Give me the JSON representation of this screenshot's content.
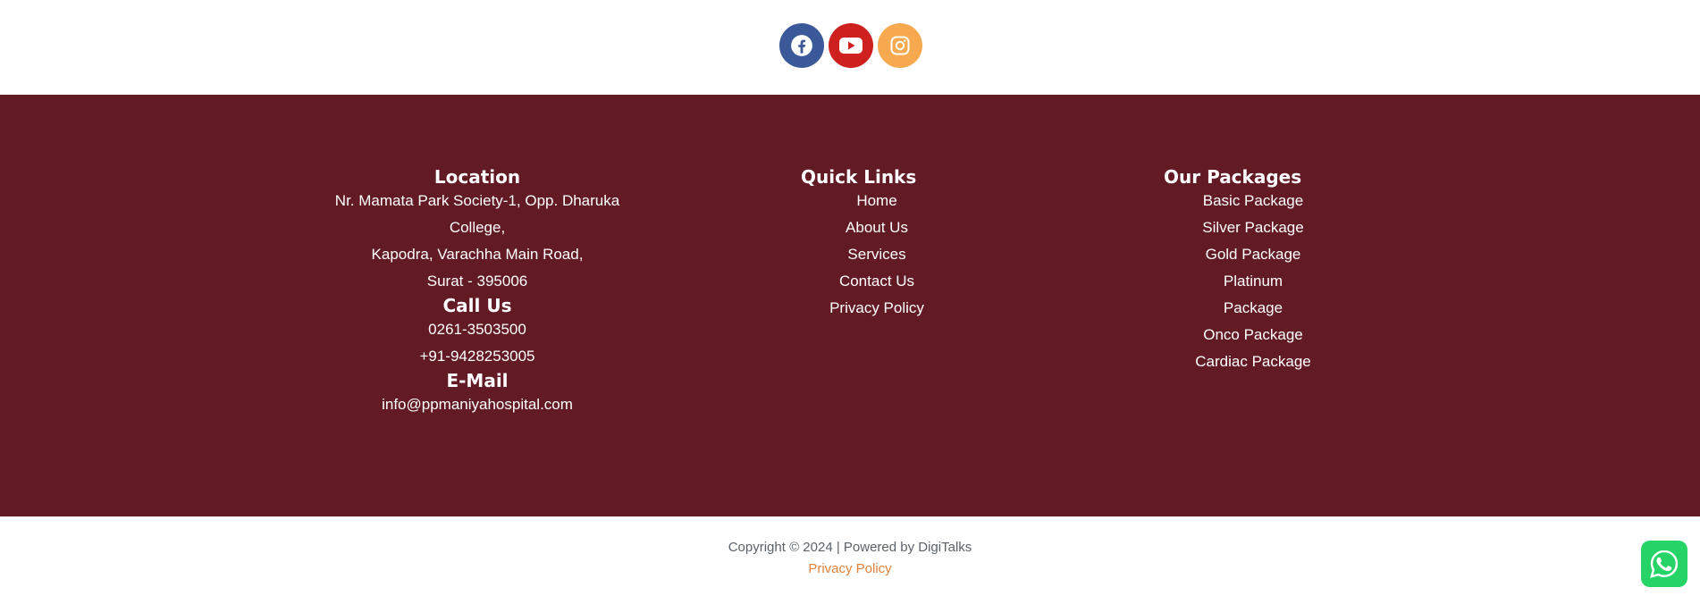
{
  "social": {
    "icons": [
      "facebook-icon",
      "youtube-icon",
      "instagram-icon"
    ],
    "colors": {
      "facebook": "#3b5998",
      "youtube": "#cd201f",
      "instagram": "#f6a94f"
    }
  },
  "footer": {
    "background": "#621a25",
    "location": {
      "heading": "Location",
      "lines": [
        "Nr. Mamata Park Society-1, Opp. Dharuka",
        "College,",
        "Kapodra, Varachha Main Road,",
        "Surat - 395006"
      ]
    },
    "call": {
      "heading": "Call Us",
      "numbers": [
        "0261-3503500",
        "+91-9428253005"
      ]
    },
    "email": {
      "heading": "E-Mail",
      "address": "info@ppmaniyahospital.com"
    },
    "quick_links": {
      "heading": "Quick Links",
      "items": [
        "Home",
        "About Us",
        "Services",
        "Contact Us",
        "Privacy Policy"
      ]
    },
    "packages": {
      "heading": "Our Packages",
      "items": [
        "Basic Package",
        "Silver Package",
        "Gold Package",
        "Platinum Package",
        "Onco Package",
        "Cardiac Package"
      ]
    }
  },
  "bottom": {
    "copyright": "Copyright © 2024 | Powered by DigiTalks",
    "privacy_link": "Privacy Policy",
    "privacy_color": "#e0823d"
  },
  "whatsapp": {
    "icon": "whatsapp-icon",
    "color": "#25d366"
  }
}
